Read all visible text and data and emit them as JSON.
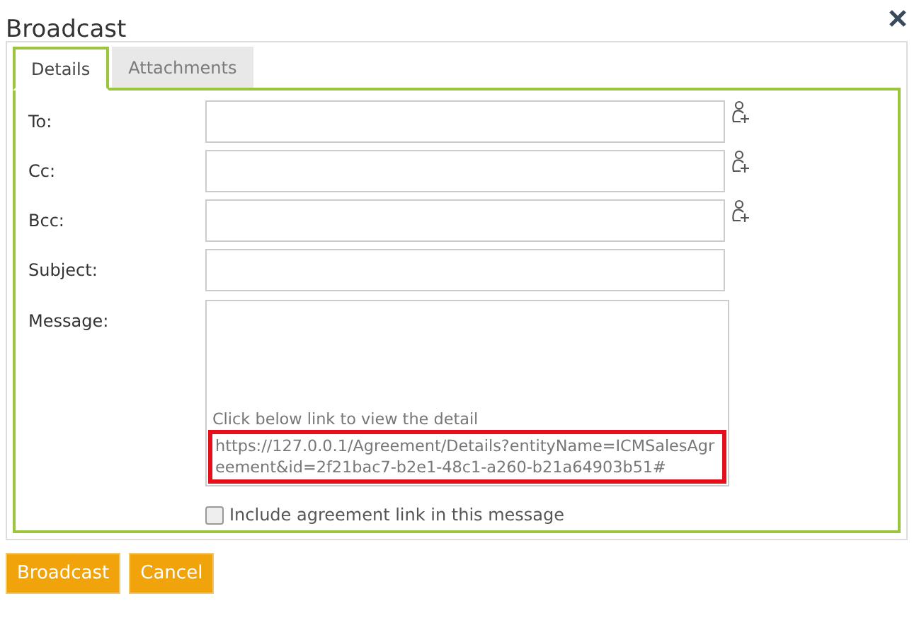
{
  "window": {
    "title": "Broadcast"
  },
  "tabs": [
    {
      "label": "Details",
      "selected": true
    },
    {
      "label": "Attachments",
      "selected": false
    }
  ],
  "fields": [
    {
      "label": "To:",
      "contact_picker": true
    },
    {
      "label": "Cc:",
      "contact_picker": true
    },
    {
      "label": "Bcc:",
      "contact_picker": true
    },
    {
      "label": "Subject:",
      "contact_picker": false
    }
  ],
  "message": {
    "label": "Message:",
    "intro": "Click below link to view the detail",
    "link": "https://127.0.0.1/Agreement/Details?entityName=ICMSalesAgreement&id=2f21bac7-b2e1-48c1-a260-b21a64903b51#",
    "link_highlighted": true
  },
  "include_link": {
    "label": "Include agreement link in this message",
    "checked": false
  },
  "buttons": [
    "Broadcast",
    "Cancel"
  ]
}
